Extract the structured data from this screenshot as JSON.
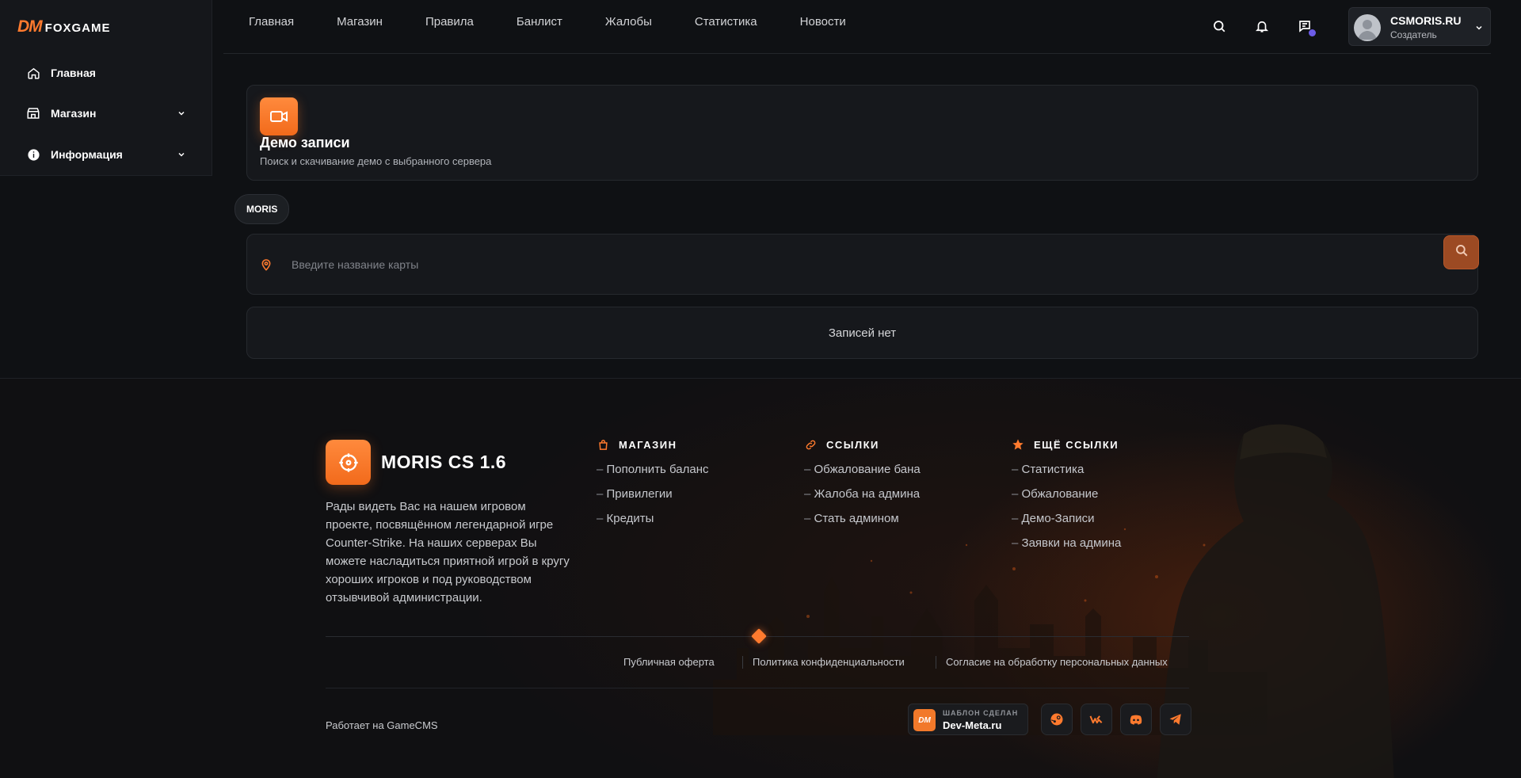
{
  "sidebar": {
    "logo_dm": "DM",
    "logo_text": "FOXGAME",
    "items": [
      {
        "label": "Главная",
        "icon": "home-icon"
      },
      {
        "label": "Магазин",
        "icon": "store-icon"
      },
      {
        "label": "Информация",
        "icon": "info-icon"
      }
    ]
  },
  "nav": {
    "links": [
      "Главная",
      "Магазин",
      "Правила",
      "Банлист",
      "Жалобы",
      "Статистика",
      "Новости"
    ]
  },
  "user": {
    "name": "CSMORIS.RU",
    "role": "Создатель"
  },
  "page": {
    "title": "Демо записи",
    "subtitle": "Поиск и скачивание демо с выбранного сервера",
    "server_chip": "MORIS",
    "search_placeholder": "Введите название карты",
    "empty_text": "Записей нет"
  },
  "footer": {
    "brand": "MORIS CS 1.6",
    "about": "Рады видеть Вас на нашем игровом проекте, посвящённом легендарной игре Counter-Strike. На наших серверах Вы можете насладиться приятной игрой в кругу хороших игроков и под руководством отзывчивой администрации.",
    "columns": [
      {
        "title": "МАГАЗИН",
        "icon": "bag-icon",
        "links": [
          "Пополнить баланс",
          "Привилегии",
          "Кредиты"
        ]
      },
      {
        "title": "ССЫЛКИ",
        "icon": "link-icon",
        "links": [
          "Обжалование бана",
          "Жалоба на админа",
          "Стать админом"
        ]
      },
      {
        "title": "ЕЩЁ ССЫЛКИ",
        "icon": "star-icon",
        "links": [
          "Статистика",
          "Обжалование",
          "Демо-Записи",
          "Заявки на админа"
        ]
      }
    ],
    "legal": [
      "Публичная оферта",
      "Политика конфиденциальности",
      "Согласие на обработку персональных данных"
    ],
    "powered": "Работает на GameCMS",
    "template_by": "ШАБЛОН СДЕЛАН",
    "template_site": "Dev-Meta.ru",
    "template_badge": "DM",
    "socials": [
      "steam-icon",
      "vk-icon",
      "discord-icon",
      "telegram-icon"
    ]
  },
  "colors": {
    "accent": "#ff7a2e",
    "background": "#0f1114",
    "card": "#16181c",
    "notification_dot": "#6c5ce7"
  }
}
